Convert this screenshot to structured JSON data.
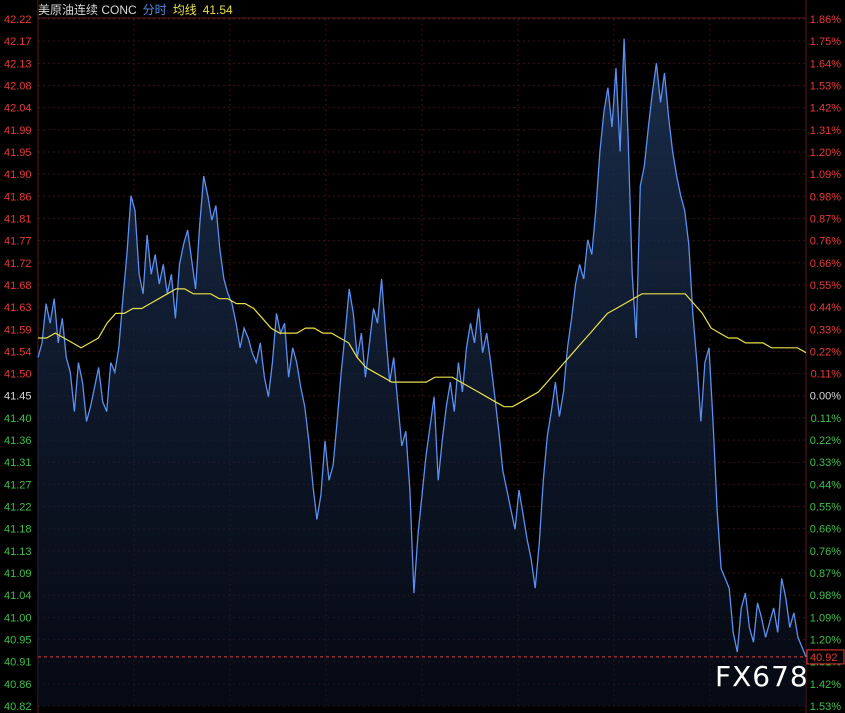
{
  "header": {
    "symbol": "美原油连续 CONC",
    "tab": "分时",
    "avg_label": "均线",
    "avg_value": "41.54"
  },
  "colors": {
    "background": "#000000",
    "grid": "#3a1414",
    "price_line": "#5b8ff0",
    "avg_line": "#e8e04a",
    "up": "#e8393a",
    "down": "#3fbf4a",
    "neutral": "#d8d8d8",
    "last_price_box": "#e8393a"
  },
  "chart_data": {
    "type": "line",
    "base_price": 41.45,
    "last_price": 40.92,
    "ylim": [
      40.82,
      42.22
    ],
    "y_tick_labels": [
      "42.22",
      "42.17",
      "42.13",
      "42.08",
      "42.04",
      "41.99",
      "41.95",
      "41.90",
      "41.86",
      "41.81",
      "41.77",
      "41.72",
      "41.68",
      "41.63",
      "41.59",
      "41.54",
      "41.50",
      "41.45",
      "41.40",
      "41.36",
      "41.31",
      "41.27",
      "41.22",
      "41.18",
      "41.13",
      "41.09",
      "41.04",
      "41.00",
      "40.95",
      "40.91",
      "40.86",
      "40.82"
    ],
    "pct_tick_labels": [
      "1.86%",
      "1.75%",
      "1.64%",
      "1.53%",
      "1.42%",
      "1.31%",
      "1.20%",
      "1.09%",
      "0.98%",
      "0.87%",
      "0.76%",
      "0.66%",
      "0.55%",
      "0.44%",
      "0.33%",
      "0.22%",
      "0.11%",
      "0.00%",
      "0.11%",
      "0.22%",
      "0.33%",
      "0.44%",
      "0.55%",
      "0.66%",
      "0.76%",
      "0.87%",
      "0.98%",
      "1.09%",
      "1.20%",
      "1.31%",
      "1.42%",
      "1.53%"
    ],
    "last_price_label": "40.92",
    "series": [
      {
        "kind": "price",
        "values": [
          41.53,
          41.56,
          41.64,
          41.6,
          41.65,
          41.56,
          41.61,
          41.53,
          41.5,
          41.42,
          41.52,
          41.48,
          41.4,
          41.43,
          41.47,
          41.51,
          41.44,
          41.42,
          41.52,
          41.5,
          41.55,
          41.65,
          41.74,
          41.86,
          41.83,
          41.7,
          41.66,
          41.78,
          41.7,
          41.74,
          41.68,
          41.72,
          41.66,
          41.7,
          41.61,
          41.72,
          41.76,
          41.79,
          41.73,
          41.67,
          41.8,
          41.9,
          41.86,
          41.81,
          41.84,
          41.75,
          41.69,
          41.66,
          41.64,
          41.6,
          41.55,
          41.59,
          41.57,
          41.54,
          41.52,
          41.56,
          41.49,
          41.45,
          41.52,
          41.62,
          41.58,
          41.6,
          41.49,
          41.55,
          41.52,
          41.47,
          41.43,
          41.36,
          41.27,
          41.2,
          41.25,
          41.36,
          41.28,
          41.31,
          41.4,
          41.5,
          41.58,
          41.67,
          41.62,
          41.53,
          41.58,
          41.49,
          41.56,
          41.63,
          41.6,
          41.69,
          41.58,
          41.48,
          41.53,
          41.44,
          41.35,
          41.38,
          41.26,
          41.05,
          41.17,
          41.25,
          41.33,
          41.39,
          41.45,
          41.28,
          41.36,
          41.43,
          41.48,
          41.42,
          41.52,
          41.46,
          41.55,
          41.6,
          41.56,
          41.63,
          41.54,
          41.58,
          41.52,
          41.45,
          41.38,
          41.3,
          41.26,
          41.22,
          41.18,
          41.26,
          41.21,
          41.16,
          41.12,
          41.06,
          41.15,
          41.28,
          41.37,
          41.42,
          41.48,
          41.41,
          41.46,
          41.55,
          41.61,
          41.68,
          41.72,
          41.69,
          41.77,
          41.74,
          41.83,
          41.95,
          42.03,
          42.08,
          42.0,
          42.12,
          41.95,
          42.18,
          41.98,
          41.7,
          41.57,
          41.88,
          41.92,
          42.0,
          42.07,
          42.13,
          42.05,
          42.11,
          42.02,
          41.95,
          41.9,
          41.86,
          41.83,
          41.76,
          41.62,
          41.52,
          41.4,
          41.52,
          41.55,
          41.4,
          41.22,
          41.1,
          41.08,
          41.06,
          40.97,
          40.93,
          41.02,
          41.05,
          40.98,
          40.95,
          41.03,
          41.0,
          40.96,
          40.99,
          41.02,
          40.97,
          41.08,
          41.04,
          40.98,
          41.01,
          40.96,
          40.94,
          40.92
        ]
      },
      {
        "kind": "average",
        "values": [
          41.57,
          41.57,
          41.58,
          41.57,
          41.56,
          41.55,
          41.56,
          41.57,
          41.6,
          41.62,
          41.62,
          41.63,
          41.63,
          41.64,
          41.65,
          41.66,
          41.67,
          41.67,
          41.66,
          41.66,
          41.66,
          41.65,
          41.65,
          41.64,
          41.64,
          41.63,
          41.61,
          41.59,
          41.58,
          41.58,
          41.58,
          41.59,
          41.59,
          41.58,
          41.58,
          41.57,
          41.56,
          41.53,
          41.51,
          41.5,
          41.49,
          41.48,
          41.48,
          41.48,
          41.48,
          41.48,
          41.49,
          41.49,
          41.49,
          41.48,
          41.47,
          41.46,
          41.45,
          41.44,
          41.43,
          41.43,
          41.44,
          41.45,
          41.46,
          41.48,
          41.5,
          41.52,
          41.54,
          41.56,
          41.58,
          41.6,
          41.62,
          41.63,
          41.64,
          41.65,
          41.66,
          41.66,
          41.66,
          41.66,
          41.66,
          41.66,
          41.64,
          41.62,
          41.59,
          41.58,
          41.57,
          41.57,
          41.56,
          41.56,
          41.56,
          41.55,
          41.55,
          41.55,
          41.55,
          41.54
        ]
      }
    ],
    "grid": true
  },
  "watermark": "FX678"
}
